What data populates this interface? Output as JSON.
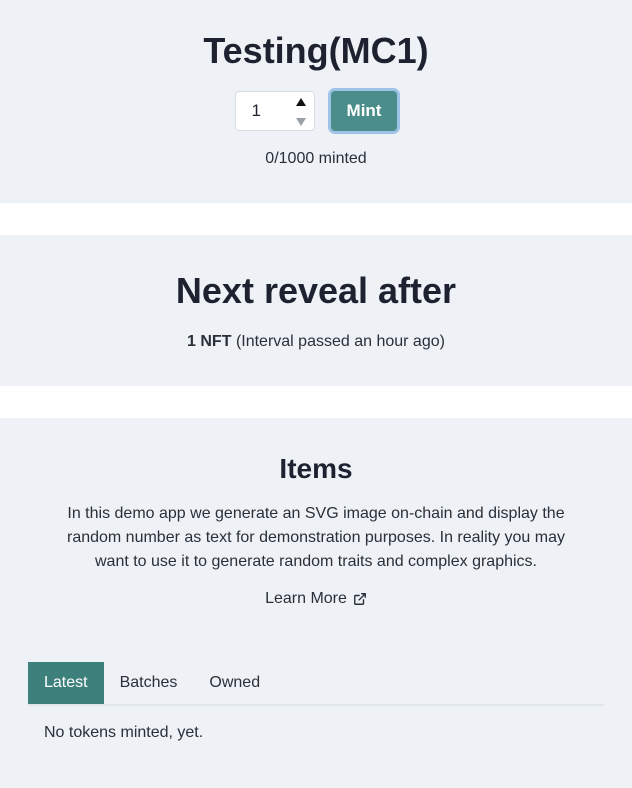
{
  "mint": {
    "title": "Testing(MC1)",
    "quantity_value": "1",
    "mint_label": "Mint",
    "minted_status": "0/1000 minted"
  },
  "reveal": {
    "title": "Next reveal after",
    "count": "1 NFT",
    "note": "(Interval passed an hour ago)"
  },
  "items": {
    "title": "Items",
    "description": "In this demo app we generate an SVG image on-chain and display the random number as text for demonstration purposes. In reality you may want to use it to generate random traits and complex graphics.",
    "learn_more": "Learn More",
    "tabs": [
      {
        "label": "Latest",
        "active": true
      },
      {
        "label": "Batches",
        "active": false
      },
      {
        "label": "Owned",
        "active": false
      }
    ],
    "empty_message": "No tokens minted, yet."
  },
  "colors": {
    "panel_bg": "#eef1f6",
    "accent": "#4b8d8a",
    "tab_active": "#3d807c"
  },
  "icons": {
    "learn_more": "external-link-icon",
    "spinner_up": "caret-up-icon",
    "spinner_down": "caret-down-icon"
  }
}
